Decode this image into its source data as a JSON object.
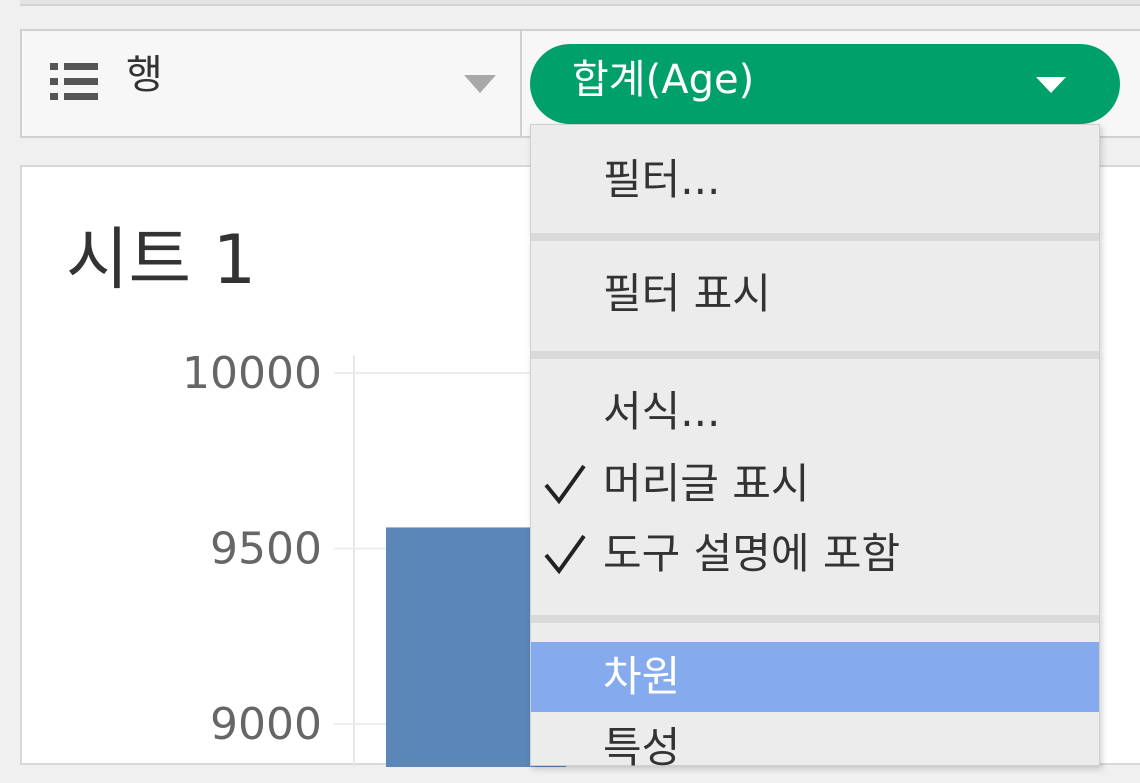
{
  "shelf": {
    "label": "행",
    "rows_icon": "list-icon",
    "dropdown_icon": "caret-down-icon",
    "pill": {
      "label": "합계(Age)",
      "color": "#00a06a",
      "dropdown_icon": "caret-down-icon"
    }
  },
  "sheet": {
    "title": "시트 1"
  },
  "chart_data": {
    "type": "bar",
    "y_ticks": [
      "10000",
      "9500",
      "9000"
    ],
    "values": [
      9560
    ],
    "bar_color": "#5b86b8",
    "ylim": [
      8900,
      10050
    ],
    "grid": true
  },
  "menu": {
    "items": [
      {
        "label": "필터...",
        "checked": false,
        "active": false
      },
      {
        "label": "필터 표시",
        "checked": false,
        "active": false
      },
      {
        "label": "서식...",
        "checked": false,
        "active": false
      },
      {
        "label": "머리글 표시",
        "checked": true,
        "active": false
      },
      {
        "label": "도구 설명에 포함",
        "checked": true,
        "active": false
      },
      {
        "label": "차원",
        "checked": false,
        "active": true
      },
      {
        "label": "특성",
        "checked": false,
        "active": false
      }
    ],
    "check_icon": "checkmark-icon",
    "highlight_color": "#85abee"
  }
}
